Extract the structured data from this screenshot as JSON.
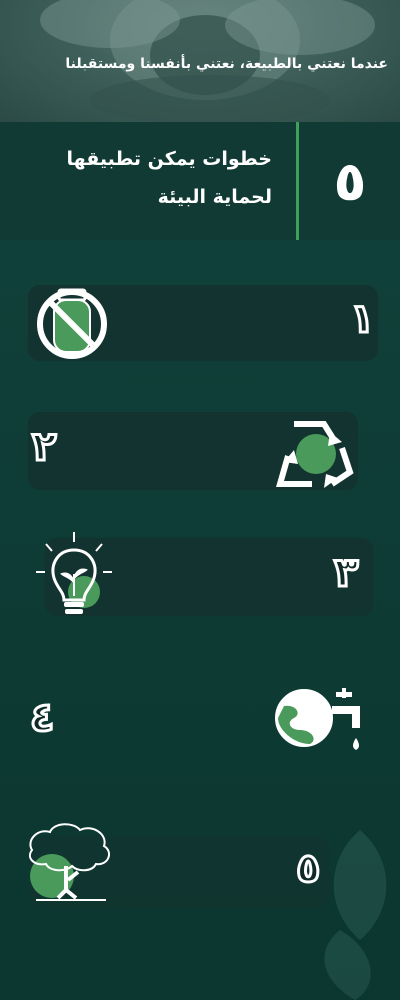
{
  "hero": {
    "tagline": "عندما نعتني بالطبيعة، نعتني بأنفسنا ومستقبلنا"
  },
  "title": {
    "number": "٥",
    "line1": "خطوات يمكن تطبيقها",
    "line2": "لحماية البيئة"
  },
  "steps": [
    {
      "number": "١",
      "icon": "no-plastic-bottle-icon"
    },
    {
      "number": "٢",
      "icon": "recycle-icon"
    },
    {
      "number": "٣",
      "icon": "eco-lightbulb-icon"
    },
    {
      "number": "٤",
      "icon": "earth-water-tap-icon"
    },
    {
      "number": "٥",
      "icon": "tree-icon"
    }
  ],
  "colors": {
    "background": "#0f3d37",
    "accent": "#3fa05a",
    "bar": "#12332f",
    "text": "#ffffff"
  }
}
